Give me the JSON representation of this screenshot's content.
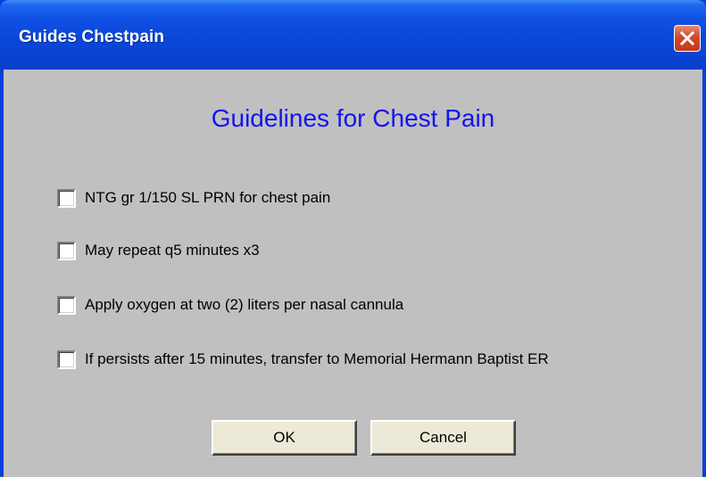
{
  "window": {
    "title": "Guides Chestpain",
    "title_bar_color": "#0a46d8",
    "close_button_color": "#d4472a"
  },
  "main": {
    "heading": "Guidelines for Chest Pain",
    "heading_color": "#1313f2",
    "items": [
      {
        "label": "NTG gr 1/150 SL PRN for chest pain",
        "checked": false
      },
      {
        "label": "May repeat q5 minutes x3",
        "checked": false
      },
      {
        "label": "Apply oxygen at two (2) liters per nasal cannula",
        "checked": false
      },
      {
        "label": "If persists after 15 minutes, transfer to Memorial Hermann Baptist ER",
        "checked": false
      }
    ]
  },
  "buttons": {
    "ok_label": "OK",
    "cancel_label": "Cancel"
  },
  "icons": {
    "close": "close-icon"
  }
}
